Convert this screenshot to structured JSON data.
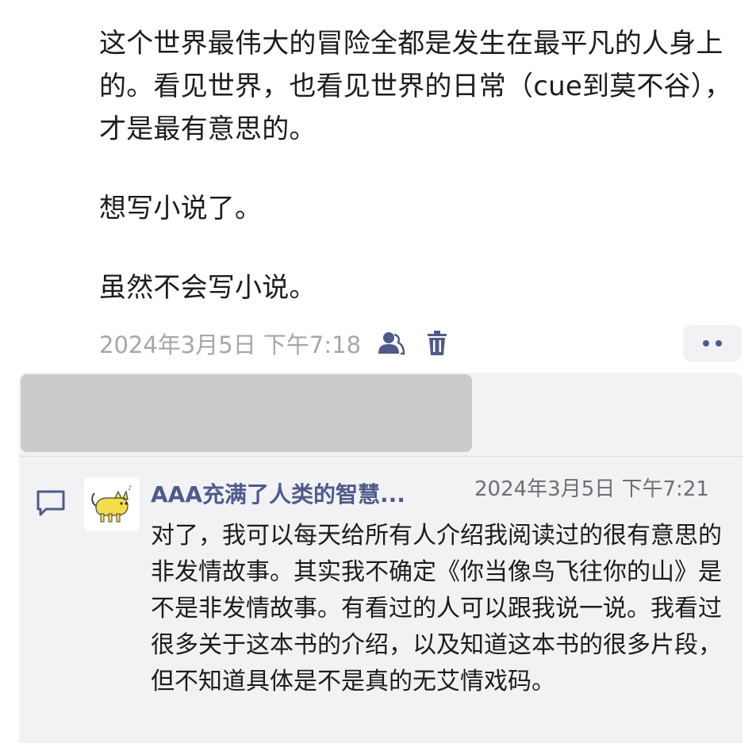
{
  "post": {
    "paragraphs": [
      "这个世界最伟大的冒险全都是发生在最平凡的人身上的。看见世界，也看见世界的日常（cue到莫不谷），才是最有意思的。",
      "想写小说了。",
      "虽然不会写小说。"
    ],
    "timestamp": "2024年3月5日 下午7:18",
    "icons": {
      "visibility": "person-icon",
      "delete": "trash-icon",
      "more": "more-dots-icon"
    }
  },
  "comments": [
    {
      "author": "AAA充满了人类的智慧...",
      "timestamp": "2024年3月5日 下午7:21",
      "body": "对了，我可以每天给所有人介绍我阅读过的很有意思的非发情故事。其实我不确定《你当像鸟飞往你的山》是不是非发情故事。有看过的人可以跟我说一说。我看过很多关于这本书的介绍，以及知道这本书的很多片段，但不知道具体是不是真的无艾情戏码。",
      "avatar_icon": "yellow-cat-avatar"
    }
  ],
  "colors": {
    "link": "#4f5a8c",
    "meta_text": "#a5a6aa",
    "panel_bg": "#f2f2f4",
    "redacted": "#cbcbcd"
  }
}
